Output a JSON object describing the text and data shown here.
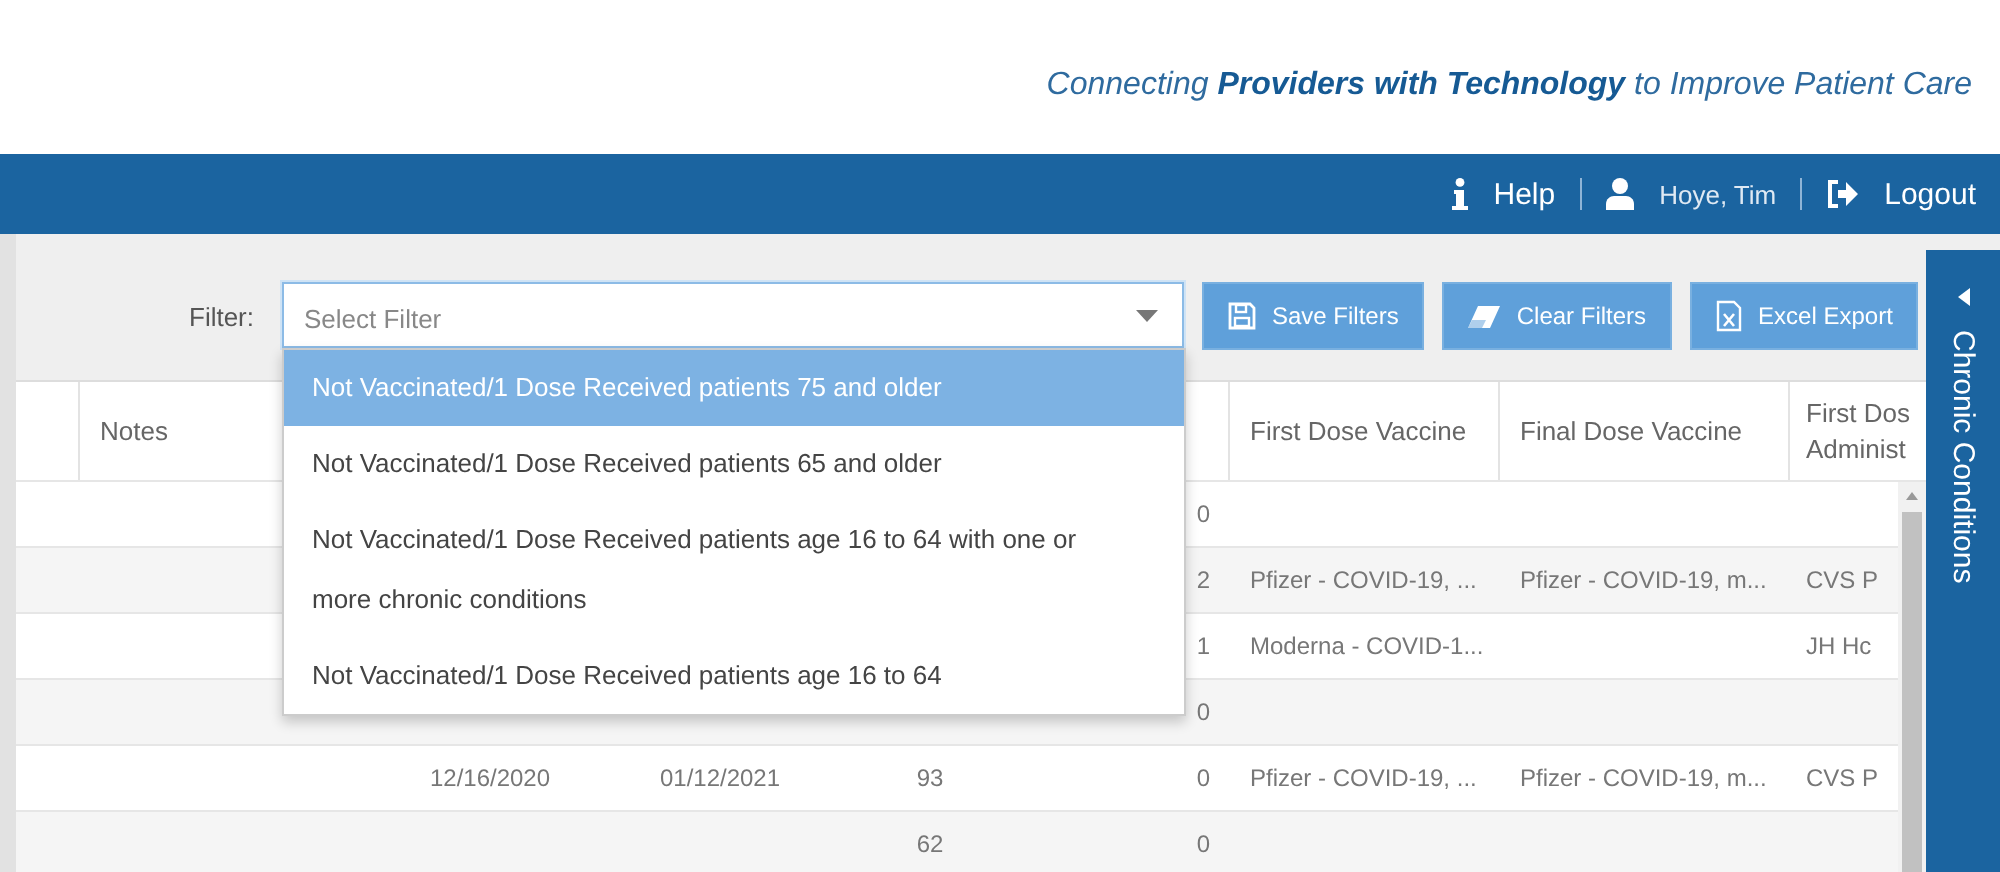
{
  "header": {
    "tagline": "Connecting **Providers with Technology** to Improve Patient Care"
  },
  "nav": {
    "help": "Help",
    "user": "Hoye, Tim",
    "logout": "Logout"
  },
  "filter": {
    "label": "Filter:",
    "placeholder": "Select Filter",
    "expanded": true,
    "options": [
      {
        "label": "Not Vaccinated/1 Dose Received patients 75 and older",
        "selected": true
      },
      {
        "label": "Not Vaccinated/1 Dose Received patients 65 and older",
        "selected": false
      },
      {
        "label": "Not Vaccinated/1 Dose Received patients age 16 to 64 with one or more chronic conditions",
        "selected": false
      },
      {
        "label": "Not Vaccinated/1 Dose Received patients age 16 to 64",
        "selected": false
      }
    ]
  },
  "buttons": [
    {
      "kind": "save",
      "label": "Save Filters"
    },
    {
      "kind": "clear",
      "label": "Clear Filters"
    },
    {
      "kind": "excel",
      "label": "Excel Export"
    }
  ],
  "table": {
    "header": {
      "column_2": "Notes",
      "column_7": "First Dose Vaccine",
      "column_8": "Final Dose Vaccine",
      "column_9": [
        "First Dos",
        "Administ"
      ]
    },
    "rows": [
      {
        "column_6": "0"
      },
      {
        "column_6": "2",
        "column_7": "Pfizer - COVID-19, ...",
        "column_8": "Pfizer - COVID-19, m...",
        "column_9": "CVS P"
      },
      {
        "column_6": "1",
        "column_7": "Moderna - COVID-1...",
        "column_9": "JH Hc"
      },
      {
        "column_6": "0"
      },
      {
        "column_3": "12/16/2020",
        "column_4": "01/12/2021",
        "column_5": "93",
        "column_6": "0",
        "column_7": "Pfizer - COVID-19, ...",
        "column_8": "Pfizer - COVID-19, m...",
        "column_9": "CVS P"
      },
      {
        "column_5": "62",
        "column_6": "0"
      }
    ]
  },
  "side_panel": {
    "label": "Chronic Conditions"
  }
}
